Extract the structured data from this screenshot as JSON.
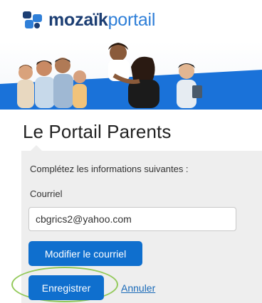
{
  "brand": {
    "name_strong": "mozaïk",
    "name_light": "portail",
    "icon": "mozaik-puzzle-logo-icon",
    "color_dark": "#1c3e73",
    "color_light": "#2f7fd8"
  },
  "banner": {
    "image": "family-photo-banner",
    "accent_color": "#1a72d9"
  },
  "page": {
    "title": "Le Portail Parents"
  },
  "form": {
    "instructions": "Complétez les informations suivantes :",
    "email_label": "Courriel",
    "email_value": "cbgrics2@yahoo.com",
    "modify_email_label": "Modifier le courriel",
    "save_label": "Enregistrer",
    "cancel_label": "Annuler"
  },
  "colors": {
    "button_bg": "#0f6fce",
    "panel_bg": "#eeeeee",
    "link": "#1a6ab8",
    "highlight": "#93c95a"
  }
}
